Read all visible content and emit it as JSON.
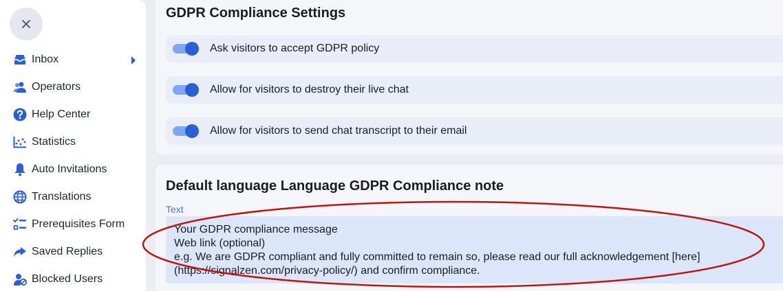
{
  "sidebar": {
    "items": [
      {
        "label": "Inbox",
        "icon": "inbox-icon"
      },
      {
        "label": "Operators",
        "icon": "operators-icon"
      },
      {
        "label": "Help Center",
        "icon": "help-icon"
      },
      {
        "label": "Statistics",
        "icon": "statistics-icon"
      },
      {
        "label": "Auto Invitations",
        "icon": "bell-icon"
      },
      {
        "label": "Translations",
        "icon": "globe-icon"
      },
      {
        "label": "Prerequisites Form",
        "icon": "checklist-icon"
      },
      {
        "label": "Saved Replies",
        "icon": "reply-icon"
      },
      {
        "label": "Blocked Users",
        "icon": "blocked-user-icon"
      }
    ]
  },
  "gdpr_settings": {
    "title": "GDPR Compliance Settings",
    "toggles": [
      {
        "label": "Ask visitors to accept GDPR policy",
        "enabled": true
      },
      {
        "label": "Allow for visitors to destroy their live chat",
        "enabled": true
      },
      {
        "label": "Allow for visitors to send chat transcript to their email",
        "enabled": true
      }
    ]
  },
  "gdpr_note": {
    "title": "Default language Language GDPR Compliance note",
    "field_label": "Text",
    "lines": [
      "Your GDPR compliance message",
      "Web link (optional)",
      "e.g. We are GDPR compliant and fully committed to remain so, please read our full acknowledgement [here]",
      "(https://signalzen.com/privacy-policy/) and confirm compliance."
    ]
  },
  "colors": {
    "accent": "#2b5fd8",
    "toggle_track": "#7fa6f2",
    "annotation": "#c0140e"
  }
}
